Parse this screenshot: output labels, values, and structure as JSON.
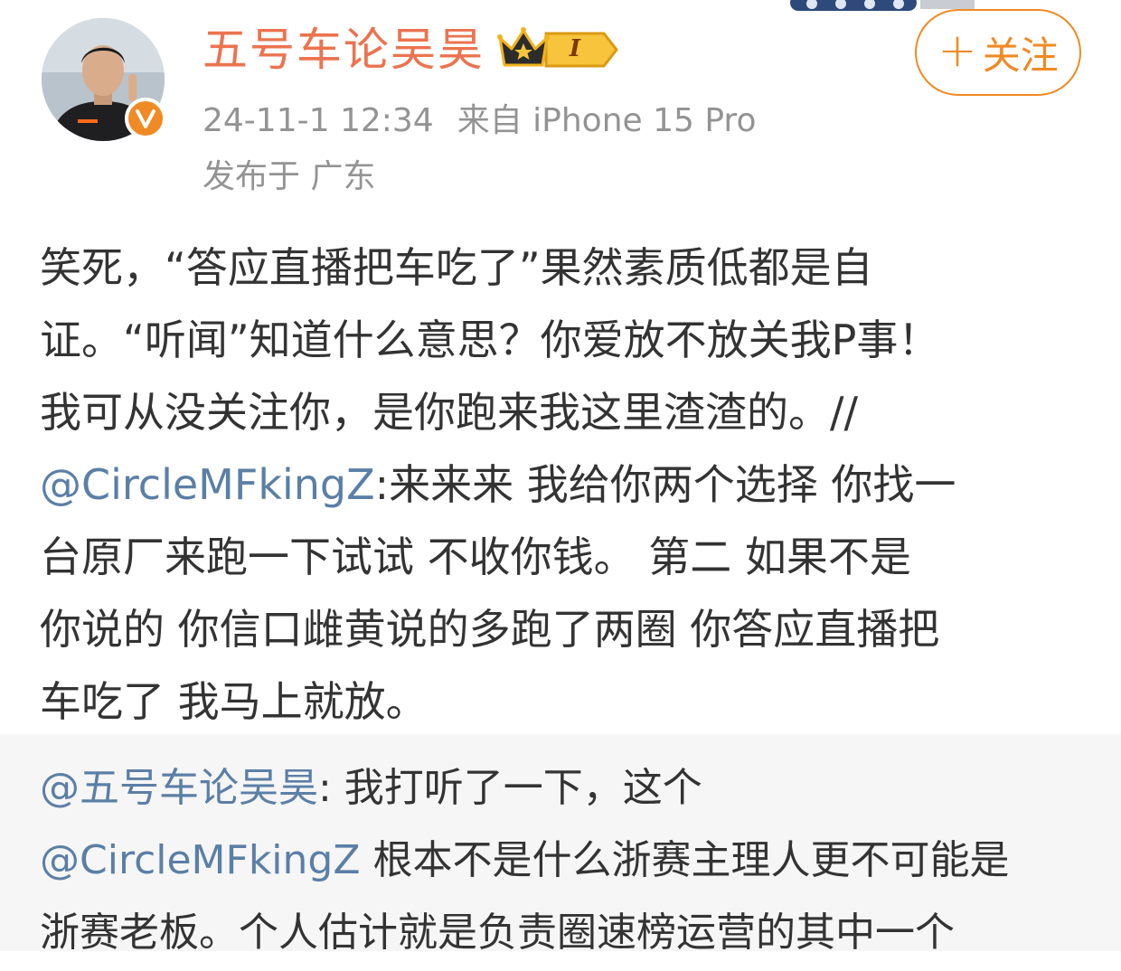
{
  "header": {
    "user_name": "五号车论吴昊",
    "level": "I",
    "follow_label": "关注",
    "timestamp": "24-11-1 12:34",
    "source": "来自 iPhone 15 Pro",
    "location": "发布于 广东"
  },
  "icons": {
    "avatar": "avatar-photo",
    "verified": "verified-badge-icon",
    "crown": "crown-icon",
    "level": "level-badge-icon",
    "follow": "plus-icon"
  },
  "colors": {
    "username": "#eb7350",
    "accent": "#f08a24",
    "mention": "#5b7fa6",
    "text": "#333333",
    "meta": "#939393"
  },
  "post": {
    "lines": [
      [
        {
          "t": "笑死，“答应直播把车吃了”果然素质低都是自"
        }
      ],
      [
        {
          "t": "证。“听闻”知道什么意思？你爱放不放关我P事！"
        }
      ],
      [
        {
          "t": "我可从没关注你，是你跑来我这里渣渣的。//"
        }
      ],
      [
        {
          "t": "@CircleMFkingZ",
          "m": true
        },
        {
          "t": ":来来来 我给你两个选择  你找一"
        }
      ],
      [
        {
          "t": "台原厂来跑一下试试 不收你钱。 第二 如果不是"
        }
      ],
      [
        {
          "t": "你说的 你信口雌黄说的多跑了两圈 你答应直播把"
        }
      ],
      [
        {
          "t": "车吃了 我马上就放。"
        }
      ]
    ]
  },
  "repost": {
    "lines": [
      [
        {
          "t": "@五号车论吴昊",
          "m": true
        },
        {
          "t": ": 我打听了一下，这个"
        }
      ],
      [
        {
          "t": "@CircleMFkingZ",
          "m": true
        },
        {
          "t": " 根本不是什么浙赛主理人更不可能是"
        }
      ],
      [
        {
          "t": "浙赛老板。个人估计就是负责圈速榜运营的其中一个"
        }
      ]
    ]
  }
}
